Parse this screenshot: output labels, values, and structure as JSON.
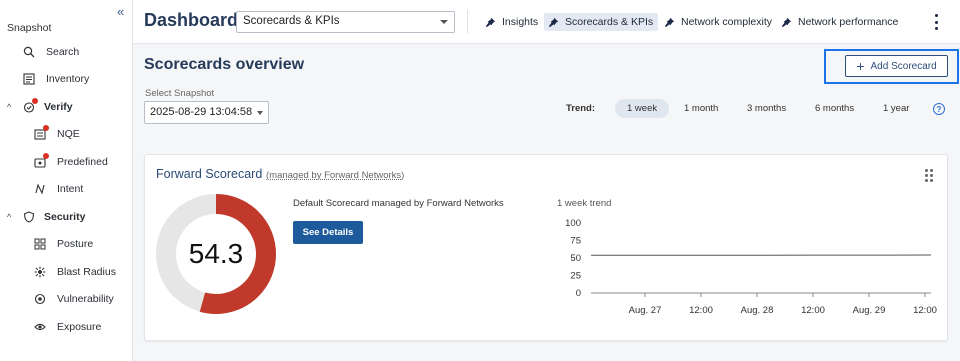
{
  "sidebar": {
    "title": "Snapshot",
    "collapse_icon": "double-chevron-left",
    "items": [
      {
        "label": "Search",
        "icon": "search-icon"
      },
      {
        "label": "Inventory",
        "icon": "inventory-icon"
      },
      {
        "label": "Verify",
        "icon": "verify-icon",
        "group": true
      },
      {
        "label": "NQE",
        "icon": "nqe-icon"
      },
      {
        "label": "Predefined",
        "icon": "predefined-icon"
      },
      {
        "label": "Intent",
        "icon": "intent-icon"
      },
      {
        "label": "Security",
        "icon": "shield-icon",
        "group": true
      },
      {
        "label": "Posture",
        "icon": "posture-icon"
      },
      {
        "label": "Blast Radius",
        "icon": "blast-radius-icon"
      },
      {
        "label": "Vulnerability",
        "icon": "vulnerability-icon"
      },
      {
        "label": "Exposure",
        "icon": "exposure-icon"
      }
    ]
  },
  "header": {
    "title": "Dashboard",
    "dashboard_select": "Scorecards & KPIs",
    "tabs": [
      {
        "label": "Insights"
      },
      {
        "label": "Scorecards & KPIs",
        "active": true
      },
      {
        "label": "Network complexity"
      },
      {
        "label": "Network performance"
      }
    ]
  },
  "main": {
    "section_title": "Scorecards overview",
    "add_button": "Add Scorecard",
    "snapshot_label": "Select Snapshot",
    "snapshot_value": "2025-08-29 13:04:58",
    "trend_label": "Trend:",
    "trend_options": [
      "1 week",
      "1 month",
      "3 months",
      "6 months",
      "1 year"
    ],
    "help_glyph": "?"
  },
  "card": {
    "title": "Forward Scorecard",
    "managed_by": "(managed by Forward Networks)",
    "score": "54.3",
    "description": "Default Scorecard managed by Forward Networks",
    "details_button": "See Details",
    "trend_caption": "1 week trend"
  },
  "colors": {
    "accent": "#263a5a",
    "donut_fill": "#c0392b",
    "donut_track": "#e6e6e6",
    "highlight": "#1a73e8",
    "primary_button": "#1d5a9c"
  },
  "chart_data": {
    "type": "line",
    "series": [
      {
        "values": [
          54.0,
          54.0,
          54.0,
          54.0,
          54.1,
          54.2,
          54.3
        ]
      }
    ],
    "x_ticks": [
      "Aug. 27",
      "12:00",
      "Aug. 28",
      "12:00",
      "Aug. 29",
      "12:00"
    ],
    "y_ticks": [
      0,
      25,
      50,
      75,
      100
    ],
    "ylim": [
      0,
      100
    ],
    "grid": false,
    "donut": {
      "value": 54.3,
      "max": 100
    }
  }
}
